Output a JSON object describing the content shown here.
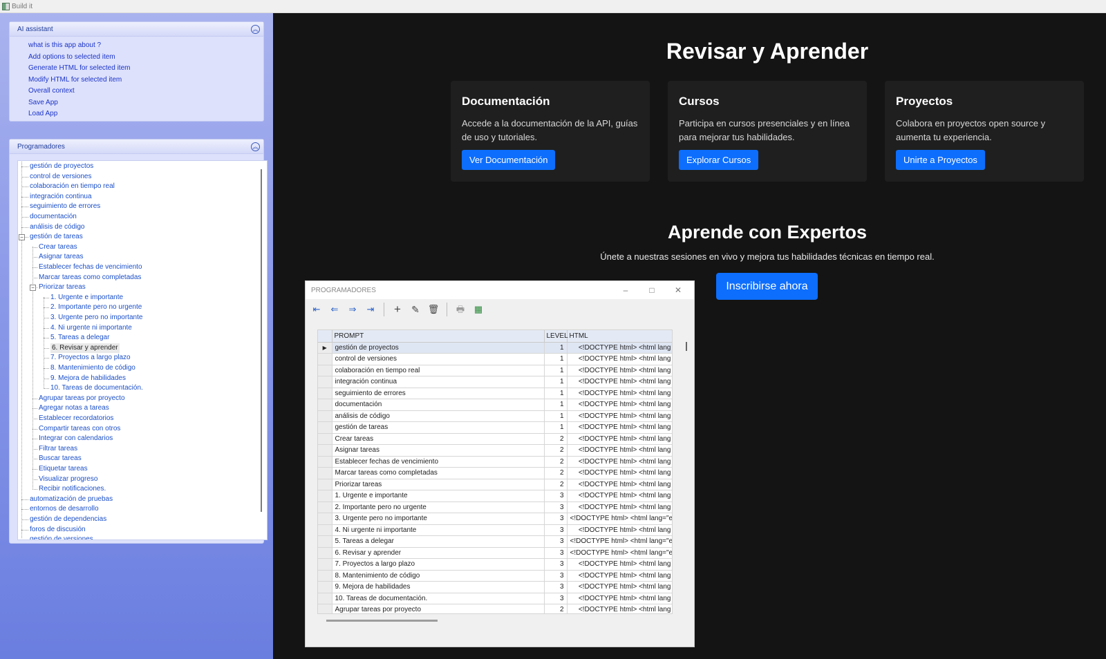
{
  "window": {
    "title": "Build it"
  },
  "ai_assistant": {
    "title": "AI assistant",
    "links": [
      "what is this app about ?",
      "Add options to selected item",
      "Generate HTML for selected item",
      "Modify HTML for selected item",
      "Overall context",
      "Save App",
      "Load App"
    ]
  },
  "programadores_panel": {
    "title": "Programadores",
    "tree": [
      {
        "label": "gestión de proyectos",
        "level": 1
      },
      {
        "label": "control de versiones",
        "level": 1
      },
      {
        "label": "colaboración en tiempo real",
        "level": 1
      },
      {
        "label": "integración continua",
        "level": 1
      },
      {
        "label": "seguimiento de errores",
        "level": 1
      },
      {
        "label": "documentación",
        "level": 1
      },
      {
        "label": "análisis de código",
        "level": 1
      },
      {
        "label": "gestión de tareas",
        "level": 1,
        "expanded": true
      },
      {
        "label": "Crear tareas",
        "level": 2
      },
      {
        "label": "Asignar tareas",
        "level": 2
      },
      {
        "label": "Establecer fechas de vencimiento",
        "level": 2
      },
      {
        "label": "Marcar tareas como completadas",
        "level": 2
      },
      {
        "label": "Priorizar tareas",
        "level": 2,
        "expanded": true
      },
      {
        "label": "1. Urgente e importante",
        "level": 3
      },
      {
        "label": "2. Importante pero no urgente",
        "level": 3
      },
      {
        "label": "3. Urgente pero no importante",
        "level": 3
      },
      {
        "label": "4. Ni urgente ni importante",
        "level": 3
      },
      {
        "label": "5. Tareas a delegar",
        "level": 3
      },
      {
        "label": "6. Revisar y aprender",
        "level": 3,
        "selected": true
      },
      {
        "label": "7. Proyectos a largo plazo",
        "level": 3
      },
      {
        "label": "8. Mantenimiento de código",
        "level": 3
      },
      {
        "label": "9. Mejora de habilidades",
        "level": 3
      },
      {
        "label": "10. Tareas de documentación.",
        "level": 3
      },
      {
        "label": "Agrupar tareas por proyecto",
        "level": 2
      },
      {
        "label": "Agregar notas a tareas",
        "level": 2
      },
      {
        "label": "Establecer recordatorios",
        "level": 2
      },
      {
        "label": "Compartir tareas con otros",
        "level": 2
      },
      {
        "label": "Integrar con calendarios",
        "level": 2
      },
      {
        "label": "Filtrar tareas",
        "level": 2
      },
      {
        "label": "Buscar tareas",
        "level": 2
      },
      {
        "label": "Etiquetar tareas",
        "level": 2
      },
      {
        "label": "Visualizar progreso",
        "level": 2
      },
      {
        "label": "Recibir notificaciones.",
        "level": 2
      },
      {
        "label": "automatización de pruebas",
        "level": 1
      },
      {
        "label": "entornos de desarrollo",
        "level": 1
      },
      {
        "label": "gestión de dependencias",
        "level": 1
      },
      {
        "label": "foros de discusión",
        "level": 1
      },
      {
        "label": "gestión de versiones",
        "level": 1
      }
    ]
  },
  "preview": {
    "title": "Revisar y Aprender",
    "cards": [
      {
        "title": "Documentación",
        "text": "Accede a la documentación de la API, guías de uso y tutoriales.",
        "button": "Ver Documentación"
      },
      {
        "title": "Cursos",
        "text": "Participa en cursos presenciales y en línea para mejorar tus habilidades.",
        "button": "Explorar Cursos"
      },
      {
        "title": "Proyectos",
        "text": "Colabora en proyectos open source y aumenta tu experiencia.",
        "button": "Unirte a Proyectos"
      }
    ],
    "experts_title": "Aprende con Expertos",
    "experts_subtitle": "Únete a nuestras sesiones en vivo y mejora tus habilidades técnicas en tiempo real.",
    "cta_button": "Inscribirse ahora"
  },
  "dialog": {
    "title": "PROGRAMADORES",
    "minimize": "–",
    "maximize": "□",
    "close": "✕",
    "columns": [
      "PROMPT",
      "LEVEL",
      "HTML"
    ],
    "rows": [
      {
        "prompt": "gestión de proyectos",
        "level": "1",
        "html": "<!DOCTYPE html>     <html lang"
      },
      {
        "prompt": "control de versiones",
        "level": "1",
        "html": "<!DOCTYPE html>     <html lang"
      },
      {
        "prompt": "colaboración en tiempo real",
        "level": "1",
        "html": "<!DOCTYPE html>     <html lang"
      },
      {
        "prompt": "integración continua",
        "level": "1",
        "html": "<!DOCTYPE html>     <html lang"
      },
      {
        "prompt": "seguimiento de errores",
        "level": "1",
        "html": "<!DOCTYPE html>     <html lang"
      },
      {
        "prompt": "documentación",
        "level": "1",
        "html": "<!DOCTYPE html>     <html lang"
      },
      {
        "prompt": "análisis de código",
        "level": "1",
        "html": "<!DOCTYPE html>     <html lang"
      },
      {
        "prompt": "gestión de tareas",
        "level": "1",
        "html": "<!DOCTYPE html>     <html lang"
      },
      {
        "prompt": "Crear tareas",
        "level": "2",
        "html": "<!DOCTYPE html>     <html lang"
      },
      {
        "prompt": "Asignar tareas",
        "level": "2",
        "html": "<!DOCTYPE html>     <html lang"
      },
      {
        "prompt": "Establecer fechas de vencimiento",
        "level": "2",
        "html": "<!DOCTYPE html>     <html lang"
      },
      {
        "prompt": "Marcar tareas como completadas",
        "level": "2",
        "html": "<!DOCTYPE html>     <html lang"
      },
      {
        "prompt": "Priorizar tareas",
        "level": "2",
        "html": "<!DOCTYPE html>     <html lang"
      },
      {
        "prompt": "1. Urgente e importante",
        "level": "3",
        "html": "<!DOCTYPE html>     <html lang"
      },
      {
        "prompt": "2. Importante pero no urgente",
        "level": "3",
        "html": "<!DOCTYPE html>     <html lang"
      },
      {
        "prompt": "3. Urgente pero no importante",
        "level": "3",
        "html": "<!DOCTYPE html> <html lang=\"es\">"
      },
      {
        "prompt": "4. Ni urgente ni importante",
        "level": "3",
        "html": "<!DOCTYPE html>     <html lang"
      },
      {
        "prompt": "5. Tareas a delegar",
        "level": "3",
        "html": "<!DOCTYPE html> <html lang=\"es\">"
      },
      {
        "prompt": "6. Revisar y aprender",
        "level": "3",
        "html": "<!DOCTYPE html> <html lang=\"es\">"
      },
      {
        "prompt": "7. Proyectos a largo plazo",
        "level": "3",
        "html": "<!DOCTYPE html>     <html lang"
      },
      {
        "prompt": "8. Mantenimiento de código",
        "level": "3",
        "html": "<!DOCTYPE html>     <html lang"
      },
      {
        "prompt": "9. Mejora de habilidades",
        "level": "3",
        "html": "<!DOCTYPE html>     <html lang"
      },
      {
        "prompt": "10. Tareas de documentación.",
        "level": "3",
        "html": "<!DOCTYPE html>     <html lang"
      },
      {
        "prompt": "Agrupar tareas por proyecto",
        "level": "2",
        "html": "<!DOCTYPE html>     <html lang"
      }
    ],
    "selected_row_marker": "▶"
  },
  "icons": {
    "collapse": "⌃⌃",
    "first": "⇤",
    "prev": "⇐",
    "next": "⇒",
    "last": "⇥",
    "add": "+",
    "edit": "✎",
    "delete": "🗑",
    "print": "🖶",
    "excel": "▦"
  },
  "colors": {
    "accent_button": "#0d6efd",
    "preview_background": "#141414",
    "link": "#1a33c8"
  }
}
